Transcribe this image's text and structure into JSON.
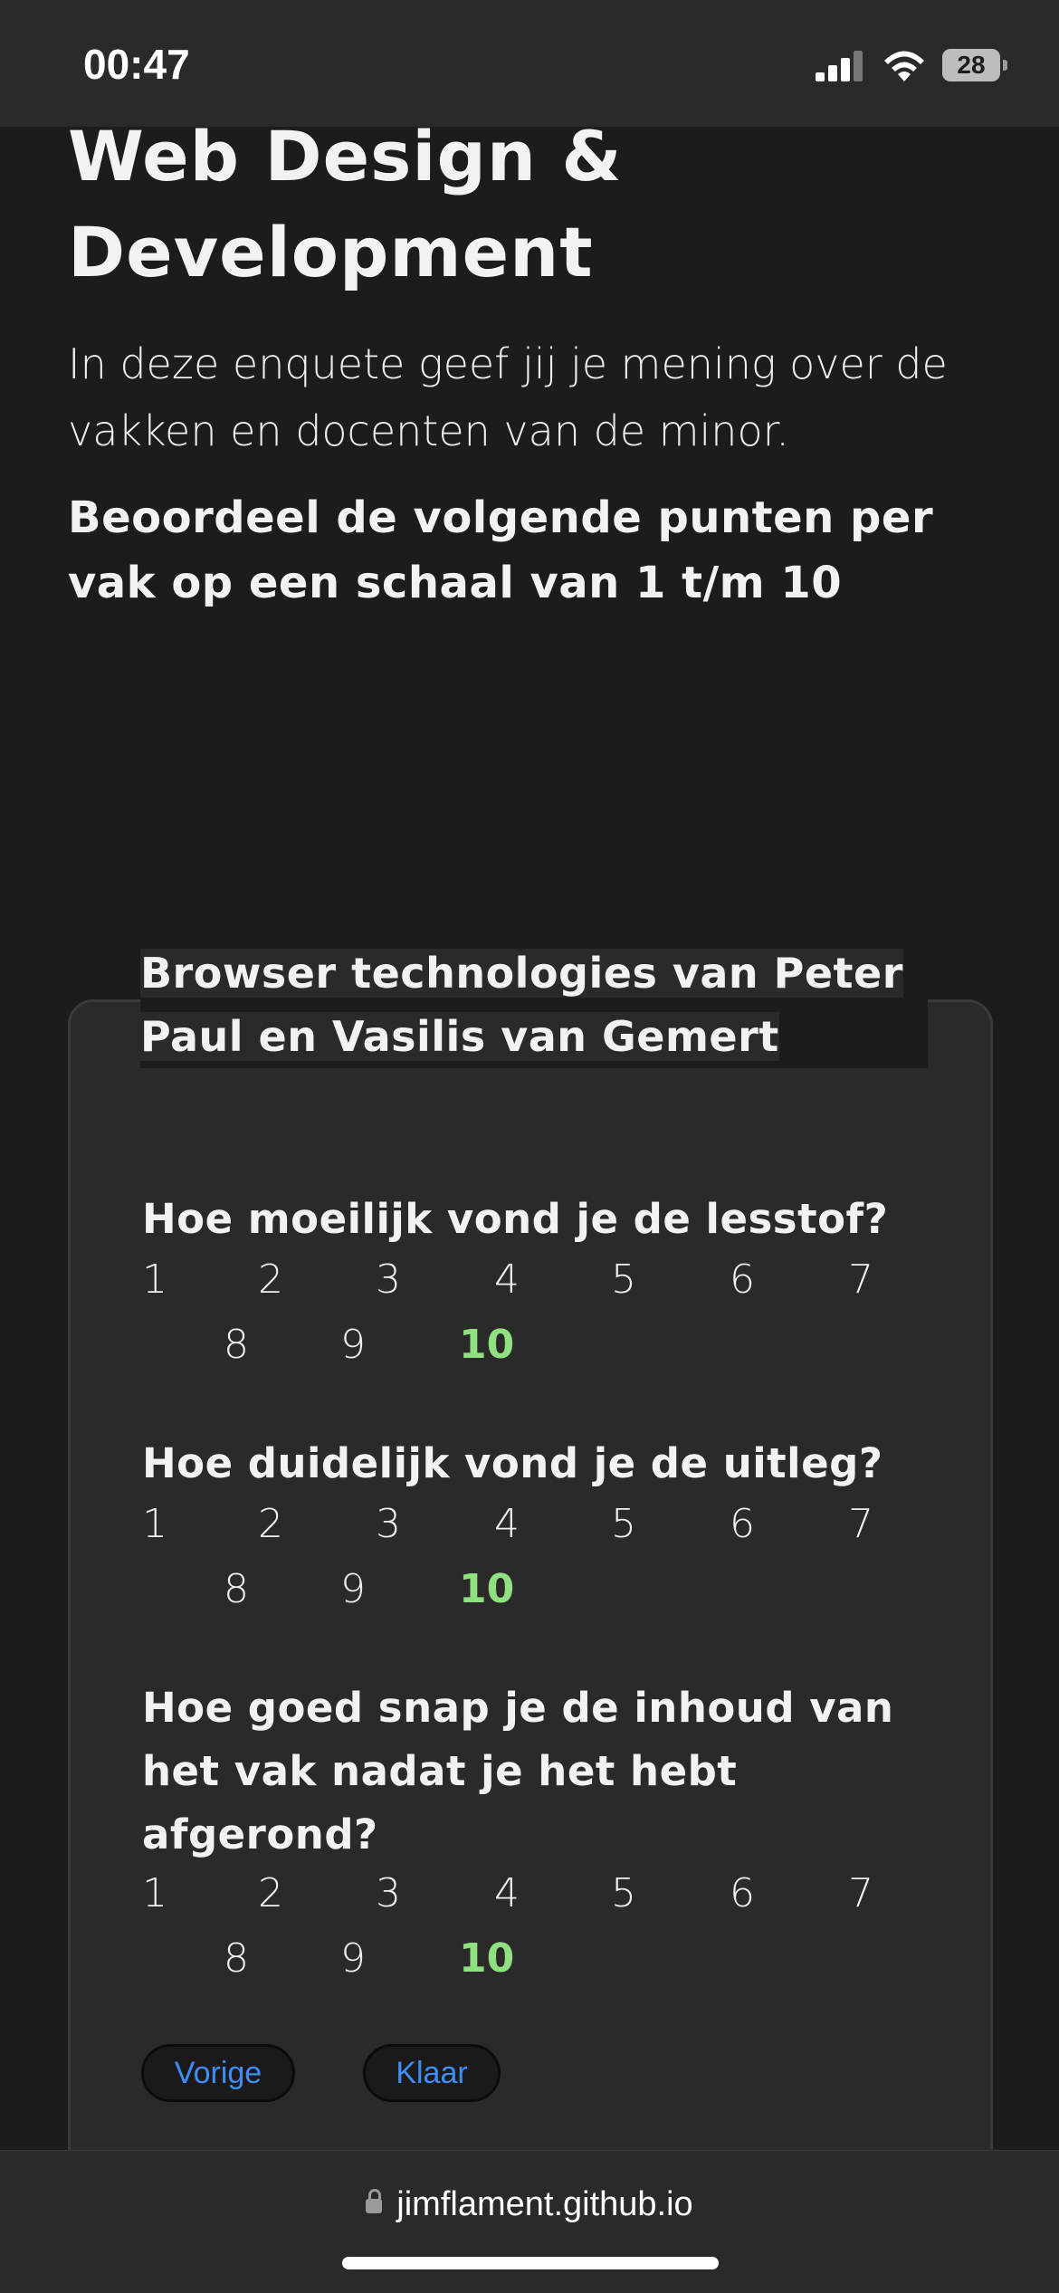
{
  "status": {
    "time": "00:47",
    "battery": "28"
  },
  "page": {
    "title": "Web Design & Development",
    "intro": "In deze enquete geef jij je mening over de vakken en docenten van de minor.",
    "instruction": "Beoordeel de volgende punten per vak op een schaal van 1 t/m 10"
  },
  "card": {
    "title": "Browser technologies van Peter Paul en Vasilis van Gemert",
    "questions": [
      {
        "label": "Hoe moeilijk vond je de lesstof?",
        "selected": "10"
      },
      {
        "label": "Hoe duidelijk vond je de uitleg?",
        "selected": "10"
      },
      {
        "label": "Hoe goed snap je de inhoud van het vak nadat je het hebt afgerond?",
        "selected": "10"
      }
    ],
    "scale": [
      "1",
      "2",
      "3",
      "4",
      "5",
      "6",
      "7",
      "8",
      "9",
      "10"
    ],
    "buttons": {
      "previous": "Vorige",
      "done": "Klaar"
    }
  },
  "browser": {
    "url": "jimflament.github.io"
  },
  "colors": {
    "background": "#1c1c1e",
    "selected": "#8fe07e",
    "link": "#3f8ef3"
  },
  "icons": [
    "signal-icon",
    "wifi-icon",
    "battery-icon",
    "lock-icon"
  ]
}
